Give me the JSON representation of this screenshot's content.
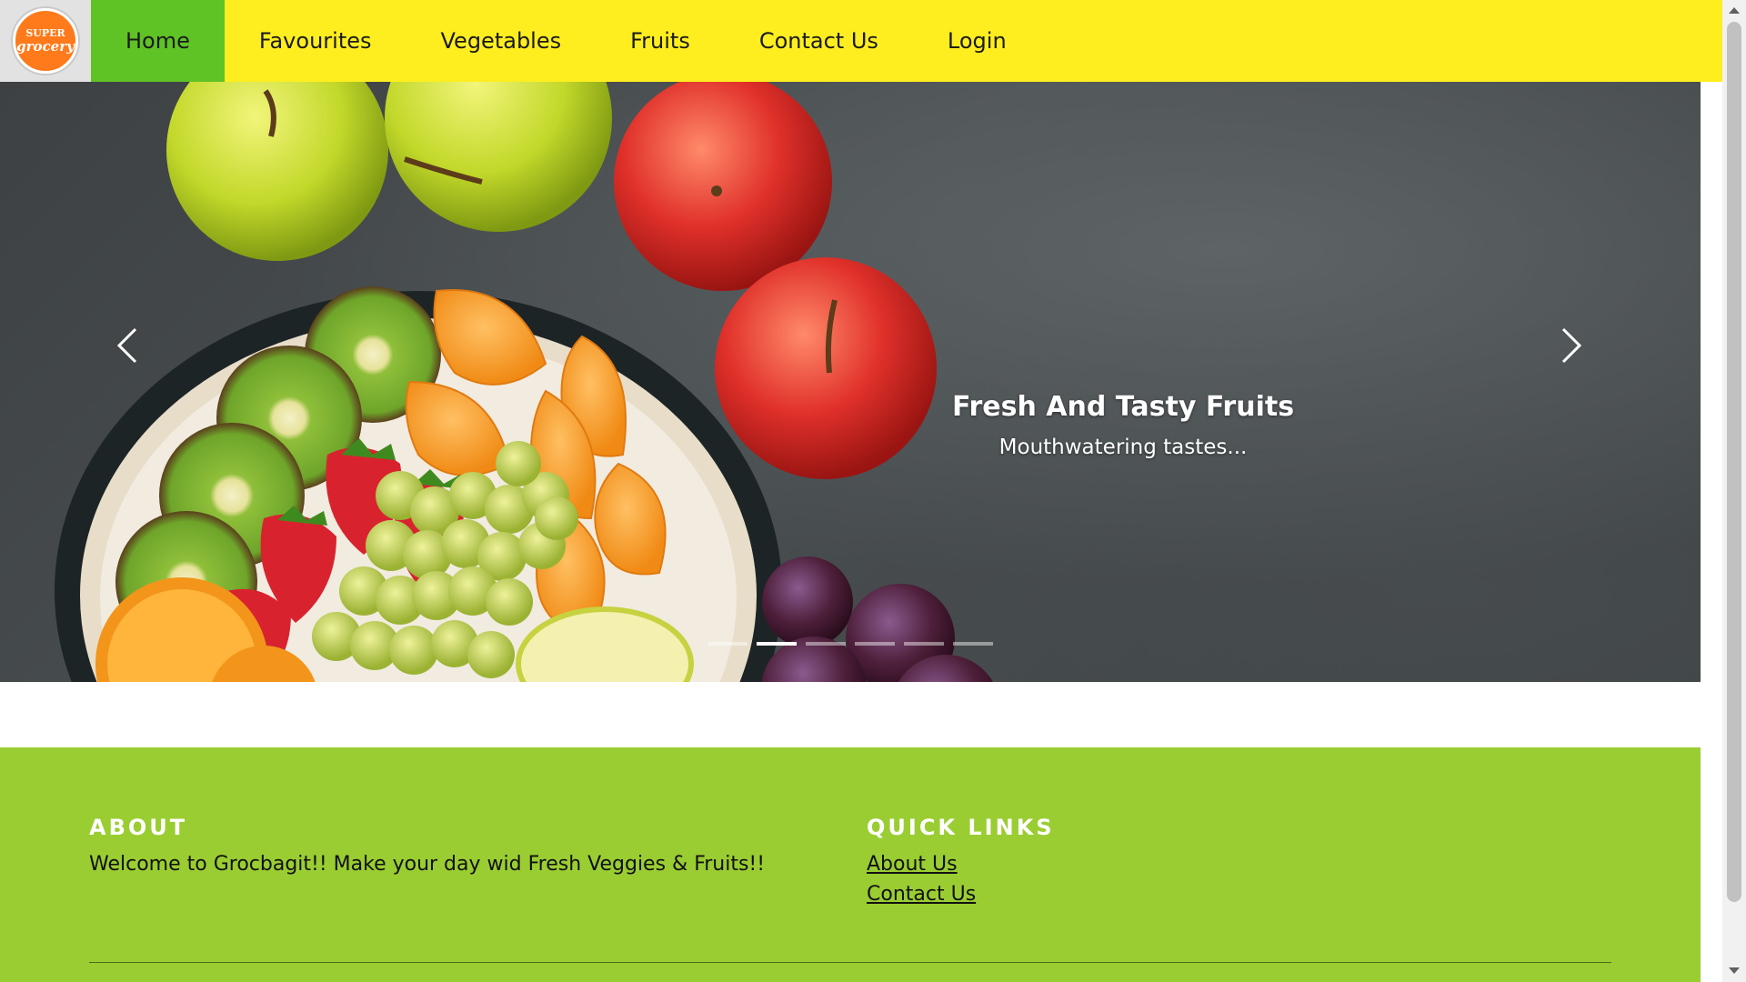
{
  "brand": {
    "logo_top": "SUPER",
    "logo_bottom": "grocery",
    "icon": "grocery-logo-icon"
  },
  "nav": {
    "items": [
      {
        "label": "Home",
        "active": true
      },
      {
        "label": "Favourites"
      },
      {
        "label": "Vegetables"
      },
      {
        "label": "Fruits"
      },
      {
        "label": "Contact Us"
      },
      {
        "label": "Login"
      }
    ]
  },
  "hero": {
    "caption_title": "Fresh And Tasty Fruits",
    "caption_subtitle": "Mouthwatering tastes...",
    "prev_icon": "chevron-left-icon",
    "next_icon": "chevron-right-icon",
    "slide_count": 6,
    "active_slide": 2
  },
  "footer": {
    "about": {
      "heading": "ABOUT",
      "text": "Welcome to Grocbagit!! Make your day wid Fresh Veggies & Fruits!!"
    },
    "quick_links": {
      "heading": "QUICK LINKS",
      "links": [
        "About Us",
        "Contact Us"
      ]
    }
  },
  "colors": {
    "navbar": "#ffee1f",
    "nav_active": "#5fc326",
    "footer": "#9acd32",
    "hero_bg": "#45494b"
  }
}
